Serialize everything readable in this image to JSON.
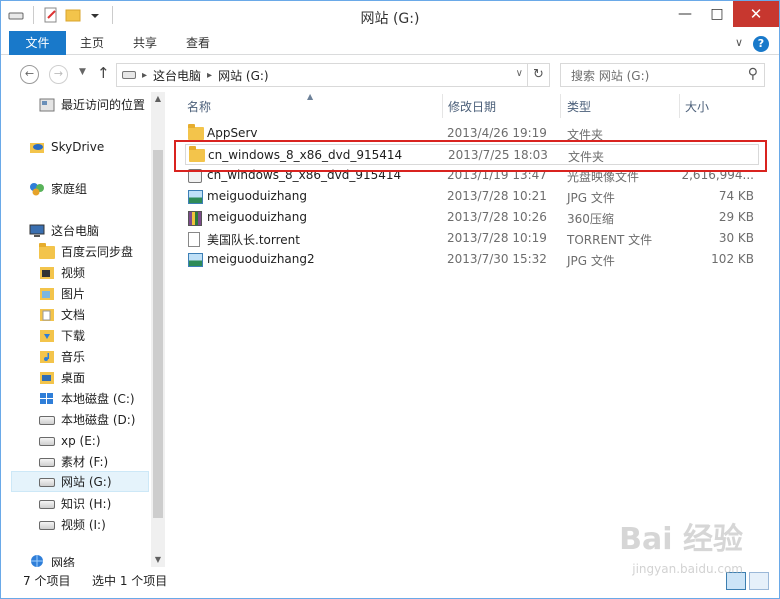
{
  "window": {
    "title": "网站 (G:)"
  },
  "ribbon": {
    "tabs": [
      "文件",
      "主页",
      "共享",
      "查看"
    ]
  },
  "address": {
    "crumbs": [
      "这台电脑",
      "网站 (G:)"
    ]
  },
  "search": {
    "placeholder": "搜索 网站 (G:)"
  },
  "sidebar": {
    "items": [
      {
        "label": "最近访问的位置",
        "icon": "recent-places-icon"
      },
      {
        "label": "SkyDrive",
        "icon": "skydrive-icon"
      },
      {
        "label": "家庭组",
        "icon": "homegroup-icon"
      },
      {
        "label": "这台电脑",
        "icon": "computer-icon"
      },
      {
        "label": "百度云同步盘",
        "icon": "folder-icon"
      },
      {
        "label": "视频",
        "icon": "videos-folder-icon"
      },
      {
        "label": "图片",
        "icon": "pictures-folder-icon"
      },
      {
        "label": "文档",
        "icon": "documents-folder-icon"
      },
      {
        "label": "下载",
        "icon": "downloads-folder-icon"
      },
      {
        "label": "音乐",
        "icon": "music-folder-icon"
      },
      {
        "label": "桌面",
        "icon": "desktop-folder-icon"
      },
      {
        "label": "本地磁盘 (C:)",
        "icon": "windows-drive-icon"
      },
      {
        "label": "本地磁盘 (D:)",
        "icon": "drive-icon"
      },
      {
        "label": "xp (E:)",
        "icon": "drive-icon"
      },
      {
        "label": "素材 (F:)",
        "icon": "drive-icon"
      },
      {
        "label": "网站 (G:)",
        "icon": "drive-icon"
      },
      {
        "label": "知识 (H:)",
        "icon": "drive-icon"
      },
      {
        "label": "视频 (I:)",
        "icon": "drive-icon"
      },
      {
        "label": "网络",
        "icon": "network-icon"
      }
    ]
  },
  "columns": {
    "name": "名称",
    "date": "修改日期",
    "type": "类型",
    "size": "大小"
  },
  "files": [
    {
      "name": "AppServ",
      "date": "2013/4/26 19:19",
      "type": "文件夹",
      "size": "",
      "icon": "folder-icon"
    },
    {
      "name": "cn_windows_8_x86_dvd_915414",
      "date": "2013/7/25 18:03",
      "type": "文件夹",
      "size": "",
      "icon": "folder-icon"
    },
    {
      "name": "cn_windows_8_x86_dvd_915414",
      "date": "2013/1/19 13:47",
      "type": "光盘映像文件",
      "size": "2,616,994...",
      "icon": "disc-image-icon"
    },
    {
      "name": "meiguoduizhang",
      "date": "2013/7/28 10:21",
      "type": "JPG 文件",
      "size": "74 KB",
      "icon": "image-icon"
    },
    {
      "name": "meiguoduizhang",
      "date": "2013/7/28 10:26",
      "type": "360压缩",
      "size": "29 KB",
      "icon": "archive-icon"
    },
    {
      "name": "美国队长.torrent",
      "date": "2013/7/28 10:19",
      "type": "TORRENT 文件",
      "size": "30 KB",
      "icon": "document-icon"
    },
    {
      "name": "meiguoduizhang2",
      "date": "2013/7/30 15:32",
      "type": "JPG 文件",
      "size": "102 KB",
      "icon": "image-icon"
    }
  ],
  "status": {
    "count": "7 个项目",
    "selected": "选中 1 个项目"
  },
  "watermark": {
    "text": "Bai 经验",
    "url": "jingyan.baidu.com"
  }
}
